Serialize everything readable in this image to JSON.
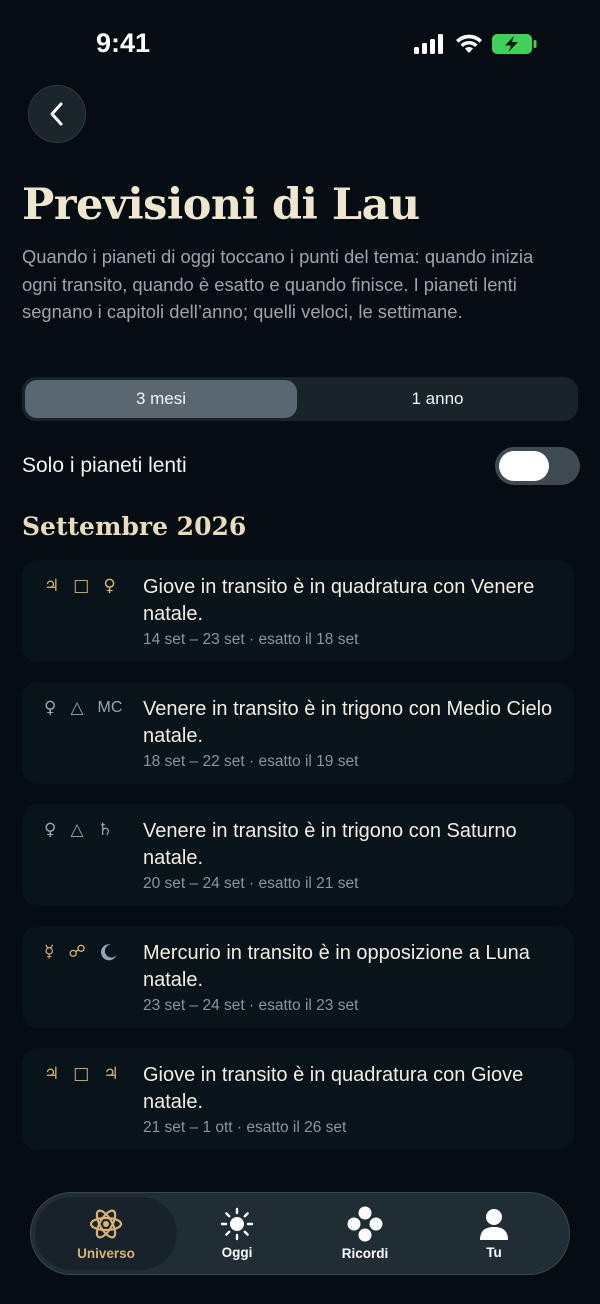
{
  "status": {
    "time": "9:41"
  },
  "header": {
    "back_icon": "chevron-left-icon",
    "title": "Previsioni di Lau",
    "description": "Quando i pianeti di oggi toccano i punti del tema: quando inizia ogni transito, quando è esatto e quando finisce. I pianeti lenti segnano i capitoli dell’anno; quelli veloci, le settimane."
  },
  "range": {
    "options": [
      "3 mesi",
      "1 anno"
    ],
    "selected": "3 mesi"
  },
  "filter": {
    "label": "Solo i pianeti lenti",
    "enabled": false
  },
  "section": {
    "title": "Settembre 2026"
  },
  "transits": [
    {
      "glyphs": [
        "♃",
        "□",
        "♀"
      ],
      "title": "Giove in transito è in quadratura con Venere natale.",
      "dates": "14 set – 23 set · esatto il 18 set"
    },
    {
      "glyphs": [
        "♀",
        "△",
        "MC"
      ],
      "title": "Venere in transito è in trigono con Medio Cielo natale.",
      "dates": "18 set – 22 set · esatto il 19 set"
    },
    {
      "glyphs": [
        "♀",
        "△",
        "♄"
      ],
      "title": "Venere in transito è in trigono con Saturno natale.",
      "dates": "20 set – 24 set · esatto il 21 set"
    },
    {
      "glyphs": [
        "☿",
        "☍",
        "☾"
      ],
      "title": "Mercurio in transito è in opposizione a Luna natale.",
      "dates": "23 set – 24 set · esatto il 23 set"
    },
    {
      "glyphs": [
        "♃",
        "□",
        "♃"
      ],
      "title": "Giove in transito è in quadratura con Giove natale.",
      "dates": "21 set – 1 ott · esatto il 26 set"
    }
  ],
  "tabs": [
    {
      "label": "Universo",
      "icon": "atom-icon",
      "active": true
    },
    {
      "label": "Oggi",
      "icon": "sun-icon",
      "active": false
    },
    {
      "label": "Ricordi",
      "icon": "dots-cluster-icon",
      "active": false
    },
    {
      "label": "Tu",
      "icon": "person-icon",
      "active": false
    }
  ],
  "colors": {
    "background": "#050d12",
    "accent_gold": "#d8b474",
    "title_cream": "#efe6cf"
  }
}
